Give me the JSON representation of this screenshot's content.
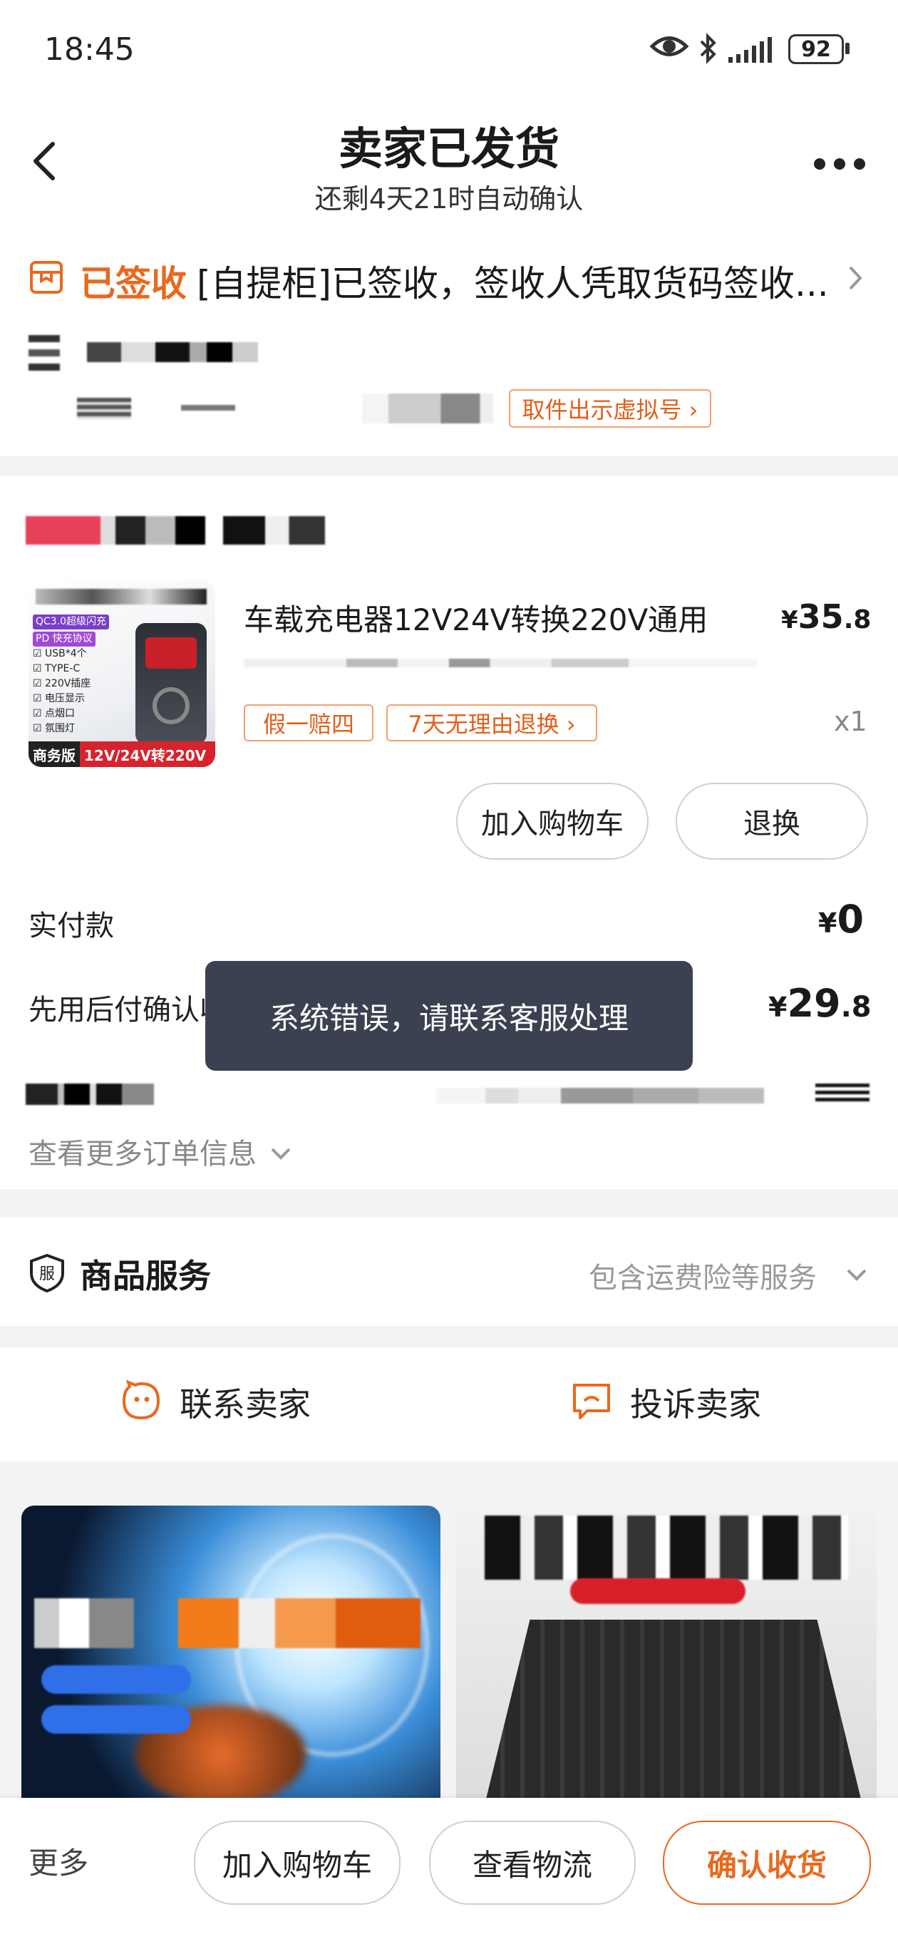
{
  "status_bar": {
    "time": "18:45",
    "battery": "92"
  },
  "header": {
    "title": "卖家已发货",
    "subtitle": "还剩4天21时自动确认"
  },
  "logistics": {
    "status": "已签收",
    "detail": "[自提柜]已签收，签收人凭取货码签收...",
    "pickup_button": "取件出示虚拟号 ›"
  },
  "product": {
    "title": "车载充电器12V24V转换220V通用",
    "price_symbol": "¥",
    "price_int": "35",
    "price_dec": ".8",
    "qty": "x1",
    "tags": [
      "假一赔四",
      "7天无理由退换 ›"
    ],
    "thumb_lines": [
      "QC3.0超级闪充",
      "PD 快充协议",
      "☑ USB*4个",
      "☑ TYPE-C",
      "☑ 220V插座",
      "☑ 电压显示",
      "☑ 点烟口",
      "☑ 氛围灯"
    ],
    "thumb_badge_left": "商务版",
    "thumb_badge_right": "12V/24V转220V",
    "add_cart": "加入购物车",
    "exchange": "退换"
  },
  "payment": {
    "actual_label": "实付款",
    "actual_symbol": "¥",
    "actual_value": "0",
    "later_label": "先用后付确认收货后付款",
    "later_symbol": "¥",
    "later_int": "29",
    "later_dec": ".8",
    "more_info": "查看更多订单信息"
  },
  "toast": {
    "text": "系统错误，请联系客服处理"
  },
  "service": {
    "title": "商品服务",
    "summary": "包含运费险等服务"
  },
  "contact": {
    "seller": "联系卖家",
    "complain": "投诉卖家"
  },
  "bottom_bar": {
    "more": "更多",
    "add_cart": "加入购物车",
    "logistics": "查看物流",
    "confirm": "确认收货"
  },
  "colors": {
    "accent": "#e8691e",
    "toast_bg": "#3b4150"
  },
  "icons": [
    "back-icon",
    "more-dots-icon",
    "package-icon",
    "chevron-right-icon",
    "service-shield-icon",
    "chevron-down-icon",
    "chat-face-icon",
    "complaint-icon",
    "eye-icon",
    "bluetooth-icon",
    "signal-icon",
    "battery-icon"
  ]
}
